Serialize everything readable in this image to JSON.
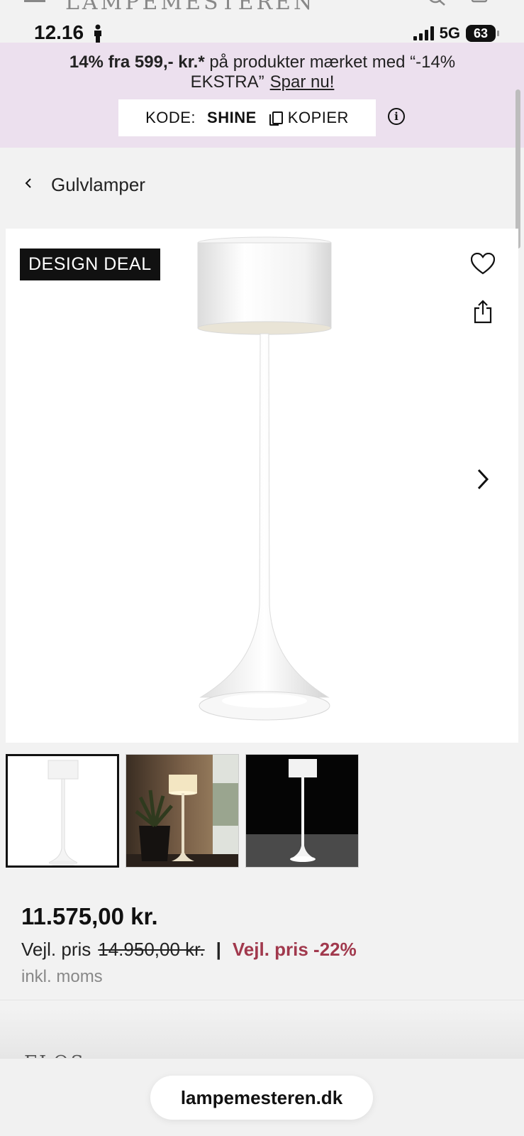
{
  "header": {
    "logo": "LAMPEMESTEREN"
  },
  "statusbar": {
    "time": "12.16",
    "network": "5G",
    "battery": "63"
  },
  "promo": {
    "text_bold": "14% fra 599,- kr.*",
    "text_rest": " på produkter mærket med “-14% EKSTRA”",
    "link": "Spar nu!",
    "code_label": "KODE:",
    "code_value": "SHINE",
    "copy_label": "KOPIER",
    "info_icon": "info-icon"
  },
  "breadcrumb": {
    "label": "Gulvlamper",
    "icon": "chevron-left-icon"
  },
  "gallery": {
    "badge": "DESIGN DEAL",
    "icons": [
      "heart-icon",
      "share-icon",
      "chevron-right-icon"
    ],
    "thumbnails": [
      "thumbnail-white-background",
      "thumbnail-living-room",
      "thumbnail-black-background"
    ],
    "active_thumbnail": 0
  },
  "pricing": {
    "price": "11.575,00 kr.",
    "rrp_label": "Vejl. pris",
    "rrp_old": "14.950,00 kr.",
    "separator": "|",
    "discount": "Vejl. pris -22%",
    "vat": "inkl. moms"
  },
  "brand_peek": "FLOS",
  "browser": {
    "url": "lampemesteren.dk"
  },
  "colors": {
    "promo_bg": "#ece0ee",
    "discount": "#a1394d",
    "page_bg": "#f2f2f2"
  }
}
